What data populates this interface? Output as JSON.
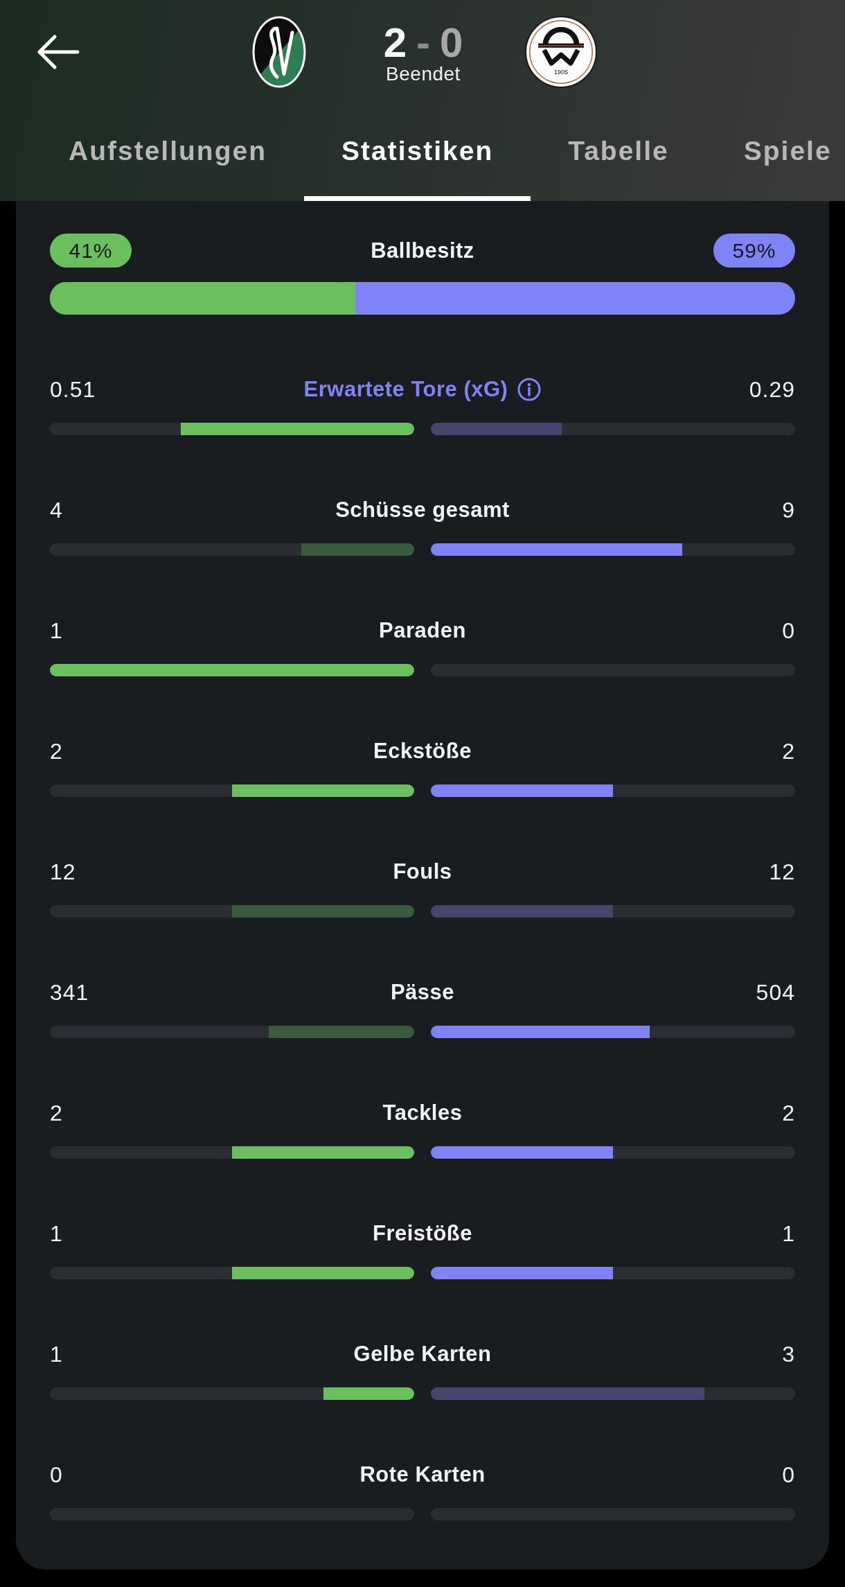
{
  "match": {
    "home_score": {
      "value": "2",
      "highlighted": true
    },
    "separator": "-",
    "away_score": {
      "value": "0",
      "highlighted": false
    },
    "status": "Beendet",
    "away_crest": {
      "year": "1905"
    }
  },
  "tabs": [
    {
      "label": "Aufstellungen",
      "selected": false
    },
    {
      "label": "Statistiken",
      "selected": true
    },
    {
      "label": "Tabelle",
      "selected": false
    },
    {
      "label": "Spiele",
      "selected": false
    }
  ],
  "possession": {
    "label": "Ballbesitz",
    "home": "41%",
    "away": "59%",
    "level": 0.41
  },
  "stats": [
    {
      "label": "Erwartete Tore (xG)",
      "kind": "info",
      "home": {
        "value": "0.51",
        "level": 0.64,
        "highlighted": true
      },
      "away": {
        "value": "0.29",
        "level": 0.36,
        "highlighted": false
      }
    },
    {
      "label": "Schüsse gesamt",
      "kind": "plain",
      "home": {
        "value": "4",
        "level": 0.31,
        "highlighted": false
      },
      "away": {
        "value": "9",
        "level": 0.69,
        "highlighted": true
      }
    },
    {
      "label": "Paraden",
      "kind": "plain",
      "home": {
        "value": "1",
        "level": 1,
        "highlighted": true
      },
      "away": {
        "value": "0"
      }
    },
    {
      "label": "Eckstöße",
      "kind": "plain",
      "home": {
        "value": "2",
        "level": 0.5,
        "highlighted": true
      },
      "away": {
        "value": "2",
        "level": 0.5,
        "highlighted": true
      }
    },
    {
      "label": "Fouls",
      "kind": "plain",
      "home": {
        "value": "12",
        "level": 0.5,
        "highlighted": false
      },
      "away": {
        "value": "12",
        "level": 0.5,
        "highlighted": false
      }
    },
    {
      "label": "Pässe",
      "kind": "plain",
      "home": {
        "value": "341",
        "level": 0.4,
        "highlighted": false
      },
      "away": {
        "value": "504",
        "level": 0.6,
        "highlighted": true
      }
    },
    {
      "label": "Tackles",
      "kind": "plain",
      "home": {
        "value": "2",
        "level": 0.5,
        "highlighted": true
      },
      "away": {
        "value": "2",
        "level": 0.5,
        "highlighted": true
      }
    },
    {
      "label": "Freistöße",
      "kind": "plain",
      "home": {
        "value": "1",
        "level": 0.5,
        "highlighted": true
      },
      "away": {
        "value": "1",
        "level": 0.5,
        "highlighted": true
      }
    },
    {
      "label": "Gelbe Karten",
      "kind": "plain",
      "home": {
        "value": "1",
        "level": 0.25,
        "highlighted": true
      },
      "away": {
        "value": "3",
        "level": 0.75,
        "highlighted": false
      }
    },
    {
      "label": "Rote Karten",
      "kind": "plain",
      "home": {
        "value": "0"
      },
      "away": {
        "value": "0"
      }
    }
  ]
}
